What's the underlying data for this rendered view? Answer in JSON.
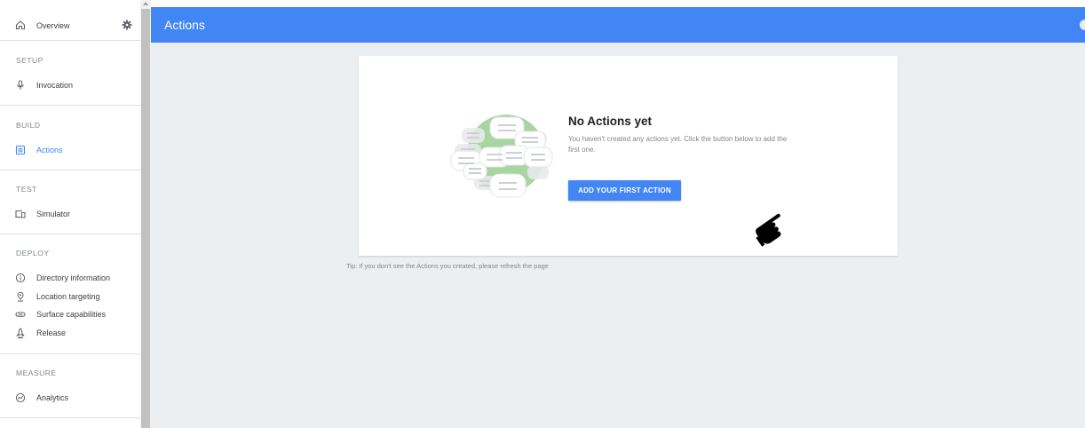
{
  "sidebar": {
    "overview_label": "Overview",
    "sections": {
      "setup": {
        "title": "SETUP",
        "items": [
          {
            "label": "Invocation"
          }
        ]
      },
      "build": {
        "title": "BUILD",
        "items": [
          {
            "label": "Actions"
          }
        ]
      },
      "test": {
        "title": "TEST",
        "items": [
          {
            "label": "Simulator"
          }
        ]
      },
      "deploy": {
        "title": "DEPLOY",
        "items": [
          {
            "label": "Directory information"
          },
          {
            "label": "Location targeting"
          },
          {
            "label": "Surface capabilities"
          },
          {
            "label": "Release"
          }
        ]
      },
      "measure": {
        "title": "MEASURE",
        "items": [
          {
            "label": "Analytics"
          }
        ]
      }
    }
  },
  "header": {
    "title": "Actions"
  },
  "empty_state": {
    "heading": "No Actions yet",
    "description": "You haven't created any actions yet. Click the button below to add the first one.",
    "button_label": "ADD YOUR FIRST ACTION"
  },
  "tip": "Tip: If you don't see the Actions you created, please refresh the page",
  "colors": {
    "primary": "#4285f4",
    "background": "#eceff1",
    "illustration_green": "#a8d5a2"
  },
  "icons": {
    "overview": "home-icon",
    "settings": "gear-icon",
    "invocation": "microphone-icon",
    "actions": "list-box-icon",
    "simulator": "devices-icon",
    "directory": "info-icon",
    "location": "location-pin-icon",
    "surface": "surface-pill-icon",
    "release": "rocket-icon",
    "analytics": "analytics-icon",
    "cursor": "pointing-hand-icon"
  }
}
